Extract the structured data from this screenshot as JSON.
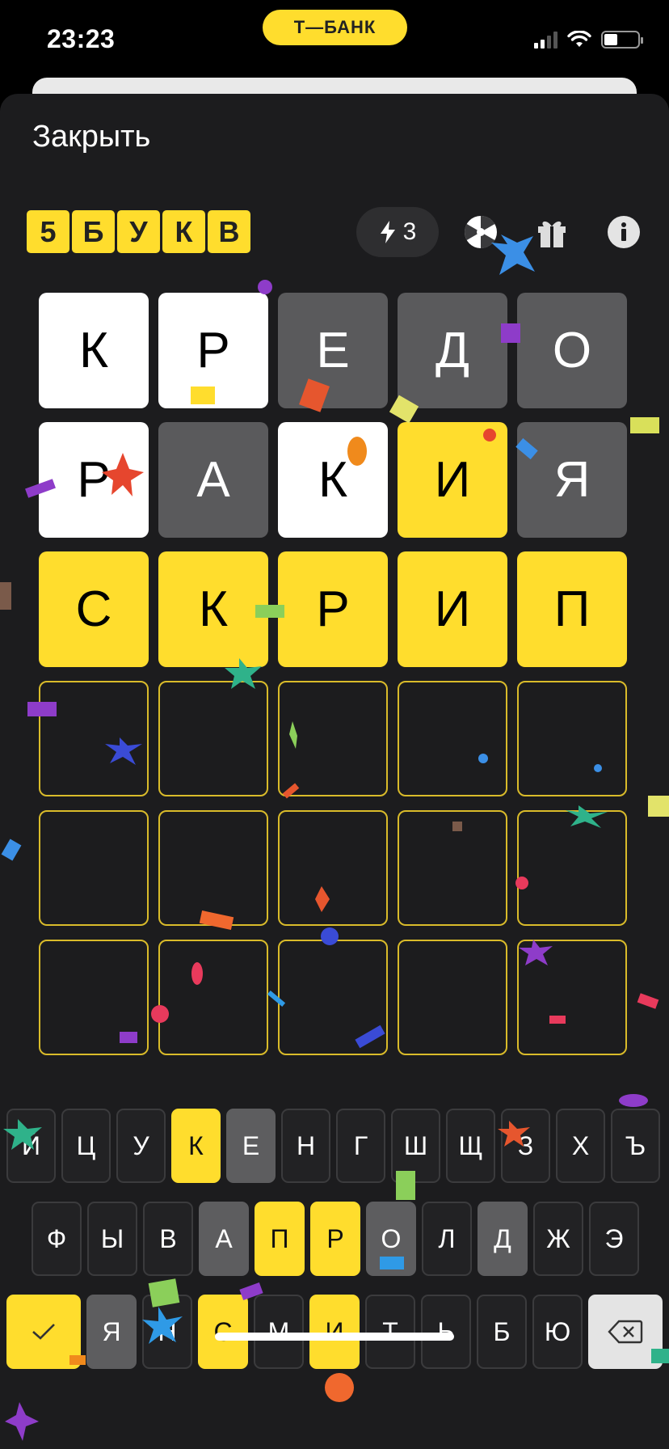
{
  "status_bar": {
    "time": "23:23",
    "bank_label": "Т—БАНК"
  },
  "header": {
    "close_label": "Закрыть",
    "logo_letters": [
      "5",
      "Б",
      "У",
      "К",
      "В"
    ],
    "energy_count": "3"
  },
  "grid": [
    [
      {
        "l": "К",
        "s": "white"
      },
      {
        "l": "Р",
        "s": "white"
      },
      {
        "l": "Е",
        "s": "gray"
      },
      {
        "l": "Д",
        "s": "gray"
      },
      {
        "l": "О",
        "s": "gray"
      }
    ],
    [
      {
        "l": "Р",
        "s": "white"
      },
      {
        "l": "А",
        "s": "gray"
      },
      {
        "l": "К",
        "s": "white"
      },
      {
        "l": "И",
        "s": "yellow"
      },
      {
        "l": "Я",
        "s": "gray"
      }
    ],
    [
      {
        "l": "С",
        "s": "yellow"
      },
      {
        "l": "К",
        "s": "yellow"
      },
      {
        "l": "Р",
        "s": "yellow"
      },
      {
        "l": "И",
        "s": "yellow"
      },
      {
        "l": "П",
        "s": "yellow"
      }
    ],
    [
      {
        "l": "",
        "s": "empty"
      },
      {
        "l": "",
        "s": "empty"
      },
      {
        "l": "",
        "s": "empty"
      },
      {
        "l": "",
        "s": "empty"
      },
      {
        "l": "",
        "s": "empty"
      }
    ],
    [
      {
        "l": "",
        "s": "empty"
      },
      {
        "l": "",
        "s": "empty"
      },
      {
        "l": "",
        "s": "empty"
      },
      {
        "l": "",
        "s": "empty"
      },
      {
        "l": "",
        "s": "empty"
      }
    ],
    [
      {
        "l": "",
        "s": "empty"
      },
      {
        "l": "",
        "s": "empty"
      },
      {
        "l": "",
        "s": "empty"
      },
      {
        "l": "",
        "s": "empty"
      },
      {
        "l": "",
        "s": "empty"
      }
    ]
  ],
  "keyboard": {
    "row1": [
      {
        "l": "Й",
        "s": "default"
      },
      {
        "l": "Ц",
        "s": "default"
      },
      {
        "l": "У",
        "s": "default"
      },
      {
        "l": "К",
        "s": "yellow"
      },
      {
        "l": "Е",
        "s": "gray"
      },
      {
        "l": "Н",
        "s": "default"
      },
      {
        "l": "Г",
        "s": "default"
      },
      {
        "l": "Ш",
        "s": "default"
      },
      {
        "l": "Щ",
        "s": "default"
      },
      {
        "l": "З",
        "s": "default"
      },
      {
        "l": "Х",
        "s": "default"
      },
      {
        "l": "Ъ",
        "s": "default"
      }
    ],
    "row2": [
      {
        "l": "Ф",
        "s": "default"
      },
      {
        "l": "Ы",
        "s": "default"
      },
      {
        "l": "В",
        "s": "default"
      },
      {
        "l": "А",
        "s": "gray"
      },
      {
        "l": "П",
        "s": "yellow"
      },
      {
        "l": "Р",
        "s": "yellow"
      },
      {
        "l": "О",
        "s": "gray"
      },
      {
        "l": "Л",
        "s": "default"
      },
      {
        "l": "Д",
        "s": "gray"
      },
      {
        "l": "Ж",
        "s": "default"
      },
      {
        "l": "Э",
        "s": "default"
      }
    ],
    "row3": [
      {
        "l": "Я",
        "s": "gray"
      },
      {
        "l": "Н",
        "s": "default"
      },
      {
        "l": "С",
        "s": "yellow"
      },
      {
        "l": "М",
        "s": "default"
      },
      {
        "l": "И",
        "s": "yellow"
      },
      {
        "l": "Т",
        "s": "default"
      },
      {
        "l": "Ь",
        "s": "default"
      },
      {
        "l": "Б",
        "s": "default"
      },
      {
        "l": "Ю",
        "s": "default"
      }
    ]
  },
  "colors": {
    "yellow": "#ffdd2d",
    "gray": "#5a5a5c",
    "background": "#1c1c1e"
  },
  "icons": {
    "energy": "lightning-icon",
    "wheel": "fortune-wheel-icon",
    "gift": "gift-icon",
    "info": "info-icon",
    "submit": "checkmark-icon",
    "delete": "backspace-icon"
  }
}
